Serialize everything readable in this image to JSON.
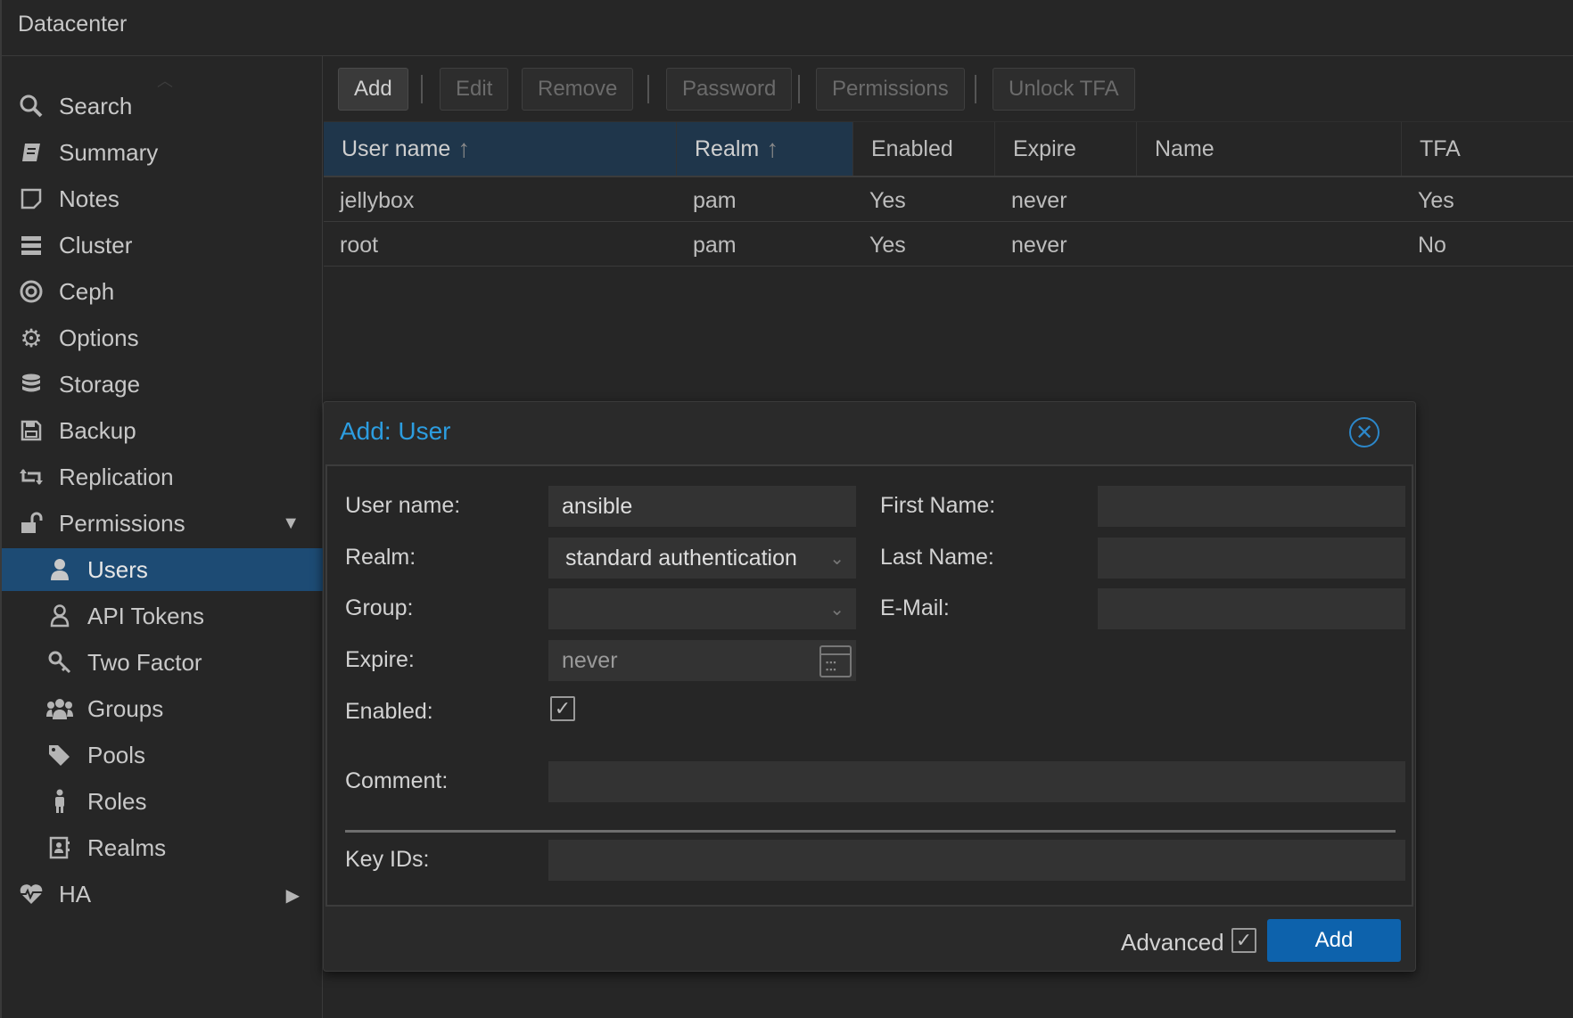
{
  "header": {
    "title": "Datacenter"
  },
  "sidebar": {
    "items": [
      {
        "label": "Search",
        "icon": "search-icon"
      },
      {
        "label": "Summary",
        "icon": "book-icon"
      },
      {
        "label": "Notes",
        "icon": "note-icon"
      },
      {
        "label": "Cluster",
        "icon": "server-icon"
      },
      {
        "label": "Ceph",
        "icon": "ceph-icon"
      },
      {
        "label": "Options",
        "icon": "gear-icon"
      },
      {
        "label": "Storage",
        "icon": "database-icon"
      },
      {
        "label": "Backup",
        "icon": "floppy-icon"
      },
      {
        "label": "Replication",
        "icon": "retweet-icon"
      },
      {
        "label": "Permissions",
        "icon": "unlock-icon"
      },
      {
        "label": "Users",
        "icon": "user-icon"
      },
      {
        "label": "API Tokens",
        "icon": "user-outline-icon"
      },
      {
        "label": "Two Factor",
        "icon": "key-icon"
      },
      {
        "label": "Groups",
        "icon": "users-icon"
      },
      {
        "label": "Pools",
        "icon": "tags-icon"
      },
      {
        "label": "Roles",
        "icon": "male-icon"
      },
      {
        "label": "Realms",
        "icon": "address-book-icon"
      },
      {
        "label": "HA",
        "icon": "heartbeat-icon"
      }
    ]
  },
  "toolbar": {
    "add": "Add",
    "edit": "Edit",
    "remove": "Remove",
    "password": "Password",
    "permissions": "Permissions",
    "unlock_tfa": "Unlock TFA"
  },
  "grid": {
    "columns": [
      "User name",
      "Realm",
      "Enabled",
      "Expire",
      "Name",
      "TFA"
    ],
    "rows": [
      [
        "jellybox",
        "pam",
        "Yes",
        "never",
        "",
        "Yes"
      ],
      [
        "root",
        "pam",
        "Yes",
        "never",
        "",
        "No"
      ]
    ]
  },
  "dialog": {
    "title": "Add: User",
    "labels": {
      "username": "User name:",
      "realm": "Realm:",
      "group": "Group:",
      "expire": "Expire:",
      "enabled": "Enabled:",
      "comment": "Comment:",
      "keyids": "Key IDs:",
      "firstname": "First Name:",
      "lastname": "Last Name:",
      "email": "E-Mail:"
    },
    "values": {
      "username": "ansible",
      "realm": "standard authentication",
      "group": "",
      "expire": "never",
      "enabled": true,
      "comment": "",
      "keyids": "",
      "firstname": "",
      "lastname": "",
      "email": ""
    },
    "advanced_label": "Advanced",
    "advanced_checked": true,
    "add_button": "Add"
  },
  "colors": {
    "accent": "#1d4b74",
    "primary_button": "#0d62ac",
    "dialog_title": "#2c9de0"
  }
}
